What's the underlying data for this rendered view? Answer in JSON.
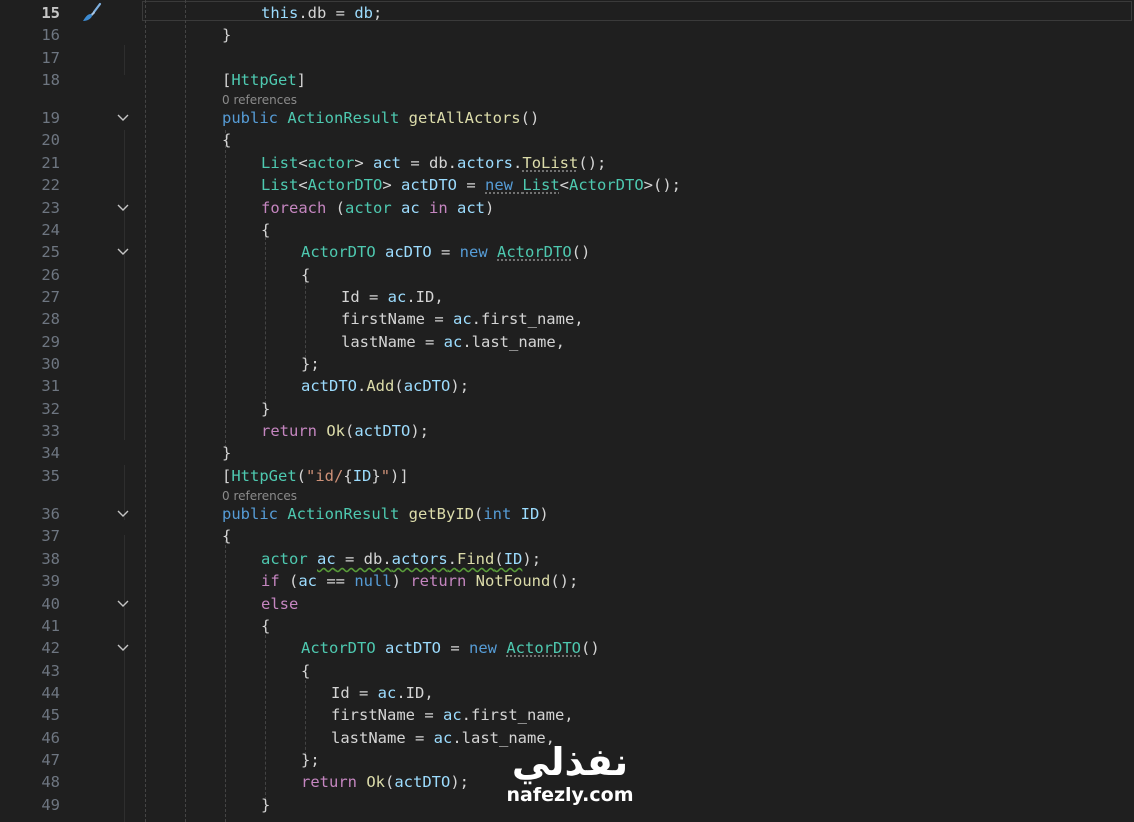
{
  "editor": {
    "active_line": "15",
    "codelens_text": "0 references",
    "lines": [
      {
        "n": "15",
        "tokens": [
          [
            "v",
            "this"
          ],
          [
            "p",
            ".db = "
          ],
          [
            "v",
            "db"
          ],
          [
            "p",
            ";"
          ]
        ]
      },
      {
        "n": "16",
        "tokens": [
          [
            "p",
            "}"
          ]
        ]
      },
      {
        "n": "17",
        "tokens": []
      },
      {
        "n": "18",
        "tokens": [
          [
            "p",
            "["
          ],
          [
            "t",
            "HttpGet"
          ],
          [
            "p",
            "]"
          ]
        ]
      },
      {
        "n": "19",
        "tokens": [
          [
            "k",
            "public "
          ],
          [
            "t",
            "ActionResult "
          ],
          [
            "m",
            "getAllActors"
          ],
          [
            "p",
            "()"
          ]
        ]
      },
      {
        "n": "20",
        "tokens": [
          [
            "p",
            "{"
          ]
        ]
      },
      {
        "n": "21",
        "tokens": [
          [
            "t",
            "List"
          ],
          [
            "p",
            "<"
          ],
          [
            "t",
            "actor"
          ],
          [
            "p",
            "> "
          ],
          [
            "v",
            "act"
          ],
          [
            "p",
            " = db."
          ],
          [
            "v",
            "actors"
          ],
          [
            "p",
            "."
          ],
          [
            "m",
            "ToList"
          ],
          [
            "p",
            "();"
          ]
        ]
      },
      {
        "n": "22",
        "tokens": [
          [
            "t",
            "List"
          ],
          [
            "p",
            "<"
          ],
          [
            "t",
            "ActorDTO"
          ],
          [
            "p",
            "> "
          ],
          [
            "v",
            "actDTO"
          ],
          [
            "p",
            " = "
          ],
          [
            "k",
            "new "
          ],
          [
            "t",
            "List"
          ],
          [
            "p",
            "<"
          ],
          [
            "t",
            "ActorDTO"
          ],
          [
            "p",
            ">();"
          ]
        ]
      },
      {
        "n": "23",
        "tokens": [
          [
            "c",
            "foreach"
          ],
          [
            "p",
            " ("
          ],
          [
            "t",
            "actor "
          ],
          [
            "v",
            "ac "
          ],
          [
            "c",
            "in "
          ],
          [
            "v",
            "act"
          ],
          [
            "p",
            ")"
          ]
        ]
      },
      {
        "n": "24",
        "tokens": [
          [
            "p",
            "{"
          ]
        ]
      },
      {
        "n": "25",
        "tokens": [
          [
            "t",
            "ActorDTO "
          ],
          [
            "v",
            "acDTO"
          ],
          [
            "p",
            " = "
          ],
          [
            "k",
            "new "
          ],
          [
            "t",
            "ActorDTO"
          ],
          [
            "p",
            "()"
          ]
        ]
      },
      {
        "n": "26",
        "tokens": [
          [
            "p",
            "{"
          ]
        ]
      },
      {
        "n": "27",
        "tokens": [
          [
            "p",
            "Id = "
          ],
          [
            "v",
            "ac"
          ],
          [
            "p",
            ".ID,"
          ]
        ]
      },
      {
        "n": "28",
        "tokens": [
          [
            "p",
            "firstName = "
          ],
          [
            "v",
            "ac"
          ],
          [
            "p",
            ".first_name,"
          ]
        ]
      },
      {
        "n": "29",
        "tokens": [
          [
            "p",
            "lastName = "
          ],
          [
            "v",
            "ac"
          ],
          [
            "p",
            ".last_name,"
          ]
        ]
      },
      {
        "n": "30",
        "tokens": [
          [
            "p",
            "};"
          ]
        ]
      },
      {
        "n": "31",
        "tokens": [
          [
            "v",
            "actDTO"
          ],
          [
            "p",
            "."
          ],
          [
            "m",
            "Add"
          ],
          [
            "p",
            "("
          ],
          [
            "v",
            "acDTO"
          ],
          [
            "p",
            ");"
          ]
        ]
      },
      {
        "n": "32",
        "tokens": [
          [
            "p",
            "}"
          ]
        ]
      },
      {
        "n": "33",
        "tokens": [
          [
            "c",
            "return "
          ],
          [
            "m",
            "Ok"
          ],
          [
            "p",
            "("
          ],
          [
            "v",
            "actDTO"
          ],
          [
            "p",
            ");"
          ]
        ]
      },
      {
        "n": "34",
        "tokens": [
          [
            "p",
            "}"
          ]
        ]
      },
      {
        "n": "35",
        "tokens": [
          [
            "p",
            "["
          ],
          [
            "t",
            "HttpGet"
          ],
          [
            "p",
            "("
          ],
          [
            "s",
            "\"id/"
          ],
          [
            "p",
            "{"
          ],
          [
            "v",
            "ID"
          ],
          [
            "p",
            "}"
          ],
          [
            "s",
            "\""
          ],
          [
            "p",
            ")]"
          ]
        ]
      },
      {
        "n": "36",
        "tokens": [
          [
            "k",
            "public "
          ],
          [
            "t",
            "ActionResult "
          ],
          [
            "m",
            "getByID"
          ],
          [
            "p",
            "("
          ],
          [
            "k",
            "int "
          ],
          [
            "v",
            "ID"
          ],
          [
            "p",
            ")"
          ]
        ]
      },
      {
        "n": "37",
        "tokens": [
          [
            "p",
            "{"
          ]
        ]
      },
      {
        "n": "38",
        "tokens": [
          [
            "t",
            "actor "
          ],
          [
            "v",
            "ac"
          ],
          [
            "p",
            " = db."
          ],
          [
            "v",
            "actors"
          ],
          [
            "p",
            "."
          ],
          [
            "m",
            "Find"
          ],
          [
            "p",
            "("
          ],
          [
            "v",
            "ID"
          ],
          [
            "p",
            ");"
          ]
        ]
      },
      {
        "n": "39",
        "tokens": [
          [
            "c",
            "if"
          ],
          [
            "p",
            " ("
          ],
          [
            "v",
            "ac"
          ],
          [
            "p",
            " == "
          ],
          [
            "k",
            "null"
          ],
          [
            "p",
            ") "
          ],
          [
            "c",
            "return "
          ],
          [
            "m",
            "NotFound"
          ],
          [
            "p",
            "();"
          ]
        ]
      },
      {
        "n": "40",
        "tokens": [
          [
            "c",
            "else"
          ]
        ]
      },
      {
        "n": "41",
        "tokens": [
          [
            "p",
            "{"
          ]
        ]
      },
      {
        "n": "42",
        "tokens": [
          [
            "t",
            "ActorDTO "
          ],
          [
            "v",
            "actDTO"
          ],
          [
            "p",
            " = "
          ],
          [
            "k",
            "new "
          ],
          [
            "t",
            "ActorDTO"
          ],
          [
            "p",
            "()"
          ]
        ]
      },
      {
        "n": "43",
        "tokens": [
          [
            "p",
            "{"
          ]
        ]
      },
      {
        "n": "44",
        "tokens": [
          [
            "p",
            "Id = "
          ],
          [
            "v",
            "ac"
          ],
          [
            "p",
            ".ID,"
          ]
        ]
      },
      {
        "n": "45",
        "tokens": [
          [
            "p",
            "firstName = "
          ],
          [
            "v",
            "ac"
          ],
          [
            "p",
            ".first_name,"
          ]
        ]
      },
      {
        "n": "46",
        "tokens": [
          [
            "p",
            "lastName = "
          ],
          [
            "v",
            "ac"
          ],
          [
            "p",
            ".last_name,"
          ]
        ]
      },
      {
        "n": "47",
        "tokens": [
          [
            "p",
            "};"
          ]
        ]
      },
      {
        "n": "48",
        "tokens": [
          [
            "c",
            "return "
          ],
          [
            "m",
            "Ok"
          ],
          [
            "p",
            "("
          ],
          [
            "v",
            "actDTO"
          ],
          [
            "p",
            ");"
          ]
        ]
      },
      {
        "n": "49",
        "tokens": [
          [
            "p",
            "}"
          ]
        ]
      }
    ]
  },
  "watermark": {
    "logo": "نفذلي",
    "site": "nafezly.com"
  },
  "icons": {
    "gutter_action": "paintbrush-icon",
    "fold": "chevron-down-icon"
  },
  "colors": {
    "background": "#1f1f1f",
    "keyword": "#569cd6",
    "control": "#c586c0",
    "type": "#4ec9b0",
    "method": "#dcdcaa",
    "variable": "#9cdcfe",
    "string": "#ce9178",
    "text": "#d4d4d4"
  }
}
